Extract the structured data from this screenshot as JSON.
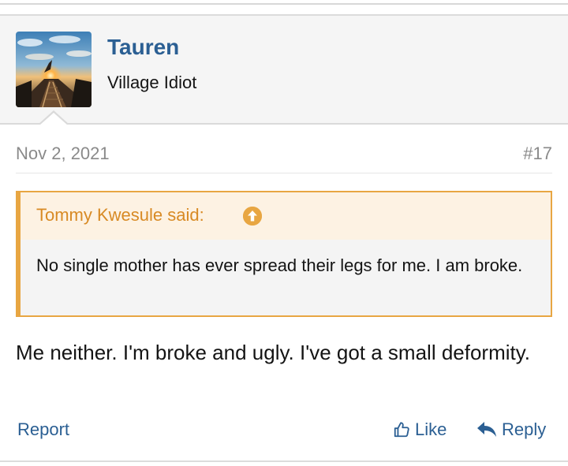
{
  "post": {
    "user": {
      "name": "Tauren",
      "title": "Village Idiot",
      "avatar_icon": "avatar-photo-icon"
    },
    "date": "Nov 2, 2021",
    "number": "#17",
    "quote": {
      "author": "Tommy Kwesule said:",
      "jump_icon": "arrow-up-circle-icon",
      "text": "No single mother has ever spread their legs for me. I am broke."
    },
    "message": "Me neither. I'm broke and ugly. I've got a small deformity.",
    "actions": {
      "report": "Report",
      "like": "Like",
      "like_icon": "thumbs-up-icon",
      "reply": "Reply",
      "reply_icon": "reply-arrow-icon"
    }
  },
  "colors": {
    "link": "#2b5f93",
    "quote_accent": "#e8a642",
    "quote_author": "#d88a24",
    "muted": "#8a8a8a"
  }
}
